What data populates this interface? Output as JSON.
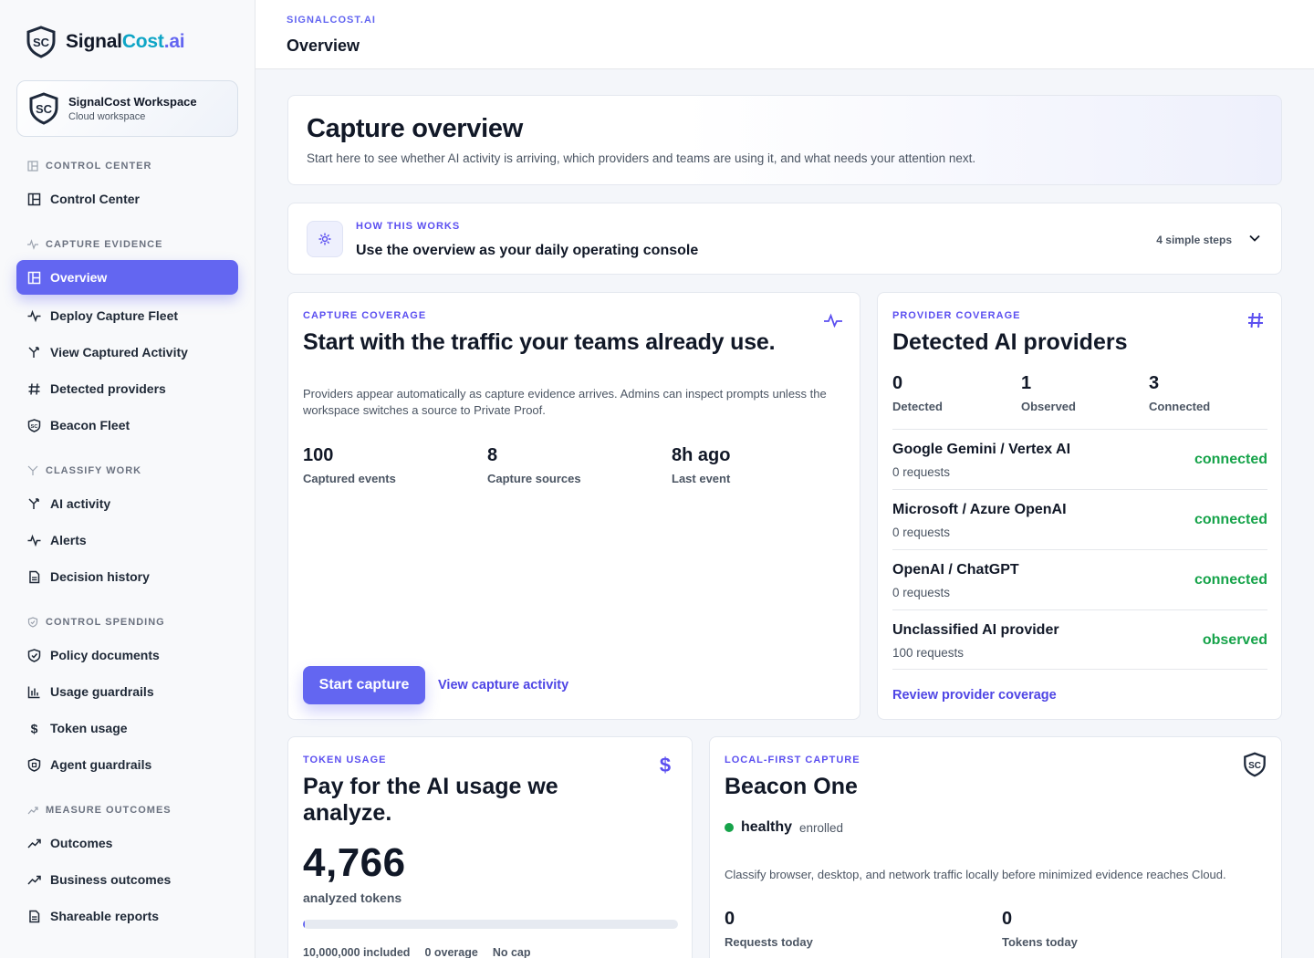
{
  "brand": {
    "part1": "Signal",
    "part2": "Cost",
    "part3": ".ai"
  },
  "workspace": {
    "title": "SignalCost Workspace",
    "subtitle": "Cloud workspace"
  },
  "nav": {
    "sections": [
      {
        "label": "CONTROL CENTER"
      },
      {
        "label": "CAPTURE EVIDENCE"
      },
      {
        "label": "CLASSIFY WORK"
      },
      {
        "label": "CONTROL SPENDING"
      },
      {
        "label": "MEASURE OUTCOMES"
      }
    ],
    "items": [
      {
        "label": "Control Center"
      },
      {
        "label": "Overview"
      },
      {
        "label": "Deploy Capture Fleet"
      },
      {
        "label": "View Captured Activity"
      },
      {
        "label": "Detected providers"
      },
      {
        "label": "Beacon Fleet"
      },
      {
        "label": "AI activity"
      },
      {
        "label": "Alerts"
      },
      {
        "label": "Decision history"
      },
      {
        "label": "Policy documents"
      },
      {
        "label": "Usage guardrails"
      },
      {
        "label": "Token usage"
      },
      {
        "label": "Agent guardrails"
      },
      {
        "label": "Outcomes"
      },
      {
        "label": "Business outcomes"
      },
      {
        "label": "Shareable reports"
      }
    ]
  },
  "header": {
    "breadcrumb": "SIGNALCOST.AI",
    "title": "Overview"
  },
  "hero": {
    "title": "Capture overview",
    "subtitle": "Start here to see whether AI activity is arriving, which providers and teams are using it, and what needs your attention next."
  },
  "how": {
    "eyebrow": "HOW THIS WORKS",
    "title": "Use the overview as your daily operating console",
    "steps": "4 simple steps"
  },
  "capture": {
    "eyebrow": "CAPTURE COVERAGE",
    "title": "Start with the traffic your teams already use.",
    "desc": "Providers appear automatically as capture evidence arrives. Admins can inspect prompts unless the workspace switches a source to Private Proof.",
    "stats": [
      {
        "value": "100",
        "label": "Captured events"
      },
      {
        "value": "8",
        "label": "Capture sources"
      },
      {
        "value": "8h ago",
        "label": "Last event"
      }
    ],
    "primary_button": "Start capture",
    "secondary_link": "View capture activity"
  },
  "providers": {
    "eyebrow": "PROVIDER COVERAGE",
    "title": "Detected AI providers",
    "stats": [
      {
        "value": "0",
        "label": "Detected"
      },
      {
        "value": "1",
        "label": "Observed"
      },
      {
        "value": "3",
        "label": "Connected"
      }
    ],
    "rows": [
      {
        "name": "Google Gemini / Vertex AI",
        "requests": "0 requests",
        "status": "connected"
      },
      {
        "name": "Microsoft / Azure OpenAI",
        "requests": "0 requests",
        "status": "connected"
      },
      {
        "name": "OpenAI / ChatGPT",
        "requests": "0 requests",
        "status": "connected"
      },
      {
        "name": "Unclassified AI provider",
        "requests": "100 requests",
        "status": "observed"
      }
    ],
    "link": "Review provider coverage",
    "status_color": "#16a34a"
  },
  "tokens": {
    "eyebrow": "TOKEN USAGE",
    "title": "Pay for the AI usage we analyze.",
    "value": "4,766",
    "value_label": "analyzed tokens",
    "progress_fraction": 0.0005,
    "meta": [
      "10,000,000 included",
      "0 overage",
      "No cap"
    ]
  },
  "beacon": {
    "eyebrow": "LOCAL-FIRST CAPTURE",
    "title": "Beacon One",
    "health": "healthy",
    "enrollment": "enrolled",
    "desc": "Classify browser, desktop, and network traffic locally before minimized evidence reaches Cloud.",
    "stats": [
      {
        "value": "0",
        "label": "Requests today"
      },
      {
        "value": "0",
        "label": "Tokens today"
      }
    ]
  },
  "colors": {
    "accent": "#6366f1",
    "success": "#16a34a",
    "text": "#111827"
  }
}
